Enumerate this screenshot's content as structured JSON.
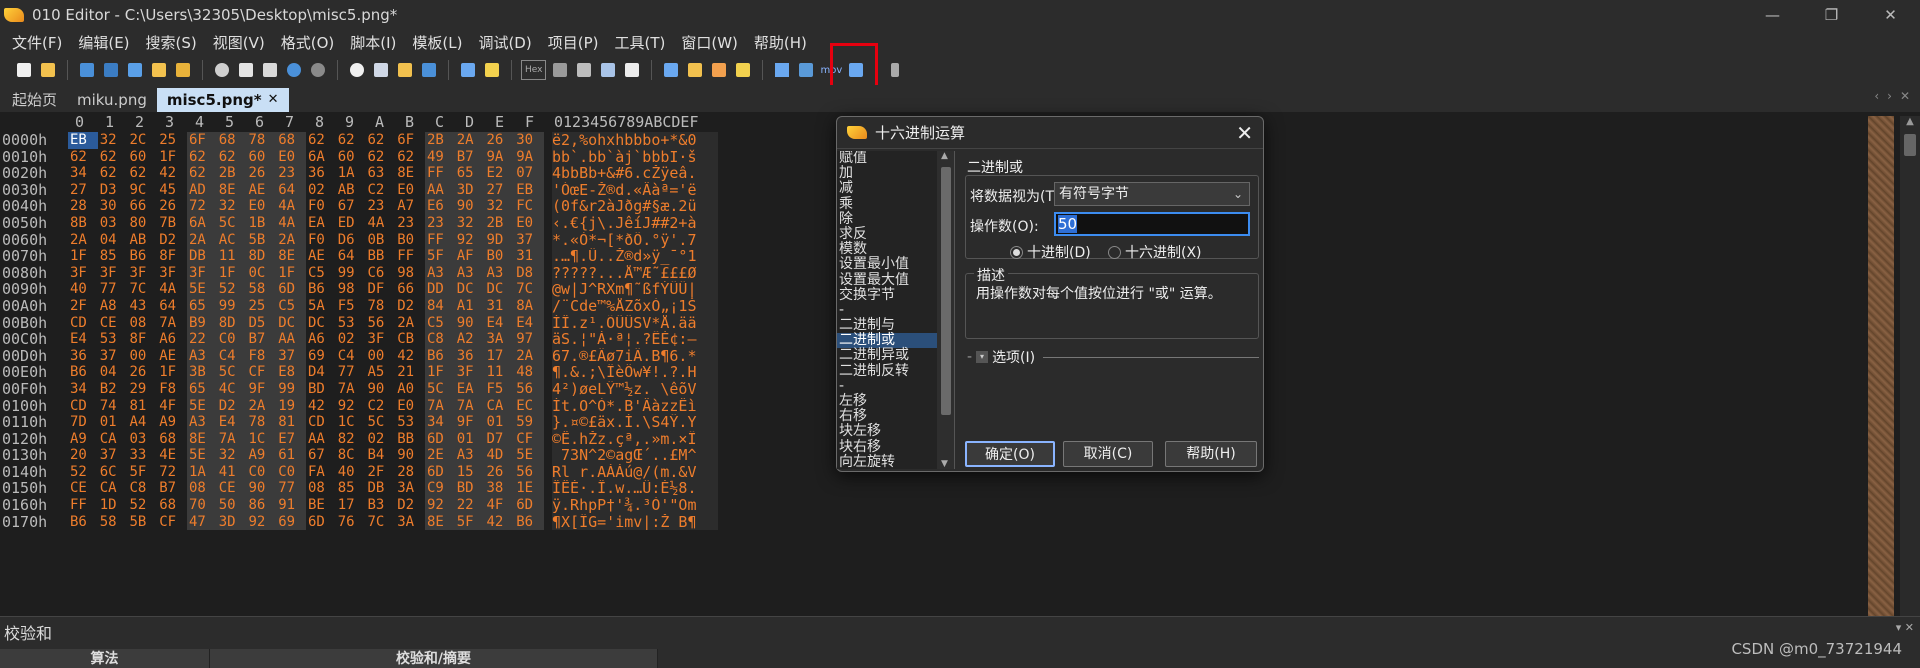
{
  "window": {
    "title": "010 Editor - C:\\Users\\32305\\Desktop\\misc5.png*",
    "controls": [
      "—",
      "❐",
      "✕"
    ]
  },
  "menu": [
    "文件(F)",
    "编辑(E)",
    "搜索(S)",
    "视图(V)",
    "格式(O)",
    "脚本(I)",
    "模板(L)",
    "调试(D)",
    "项目(P)",
    "工具(T)",
    "窗口(W)",
    "帮助(H)"
  ],
  "toolbar": {
    "hex_label": "Hex",
    "mov_label": "mov"
  },
  "tabs": [
    "起始页",
    "miku.png",
    "misc5.png*"
  ],
  "editor": {
    "col_headers": [
      "0",
      "1",
      "2",
      "3",
      "4",
      "5",
      "6",
      "7",
      "8",
      "9",
      "A",
      "B",
      "C",
      "D",
      "E",
      "F"
    ],
    "ascii_header": "0123456789ABCDEF",
    "rows": [
      {
        "addr": "0000h",
        "bytes": [
          "EB",
          "32",
          "2C",
          "25",
          "6F",
          "68",
          "78",
          "68",
          "62",
          "62",
          "62",
          "6F",
          "2B",
          "2A",
          "26",
          "30"
        ],
        "ascii": "ë2,%ohxhbbbo+*&0"
      },
      {
        "addr": "0010h",
        "bytes": [
          "62",
          "62",
          "60",
          "1F",
          "62",
          "62",
          "60",
          "E0",
          "6A",
          "60",
          "62",
          "62",
          "49",
          "B7",
          "9A",
          "9A"
        ],
        "ascii": "bb`.bb`àj`bbbI·š"
      },
      {
        "addr": "0020h",
        "bytes": [
          "34",
          "62",
          "62",
          "42",
          "62",
          "2B",
          "26",
          "23",
          "36",
          "1A",
          "63",
          "8E",
          "FF",
          "65",
          "E2",
          "07"
        ],
        "ascii": "4bbBb+&#6.cŽÿeâ."
      },
      {
        "addr": "0030h",
        "bytes": [
          "27",
          "D3",
          "9C",
          "45",
          "AD",
          "8E",
          "AE",
          "64",
          "02",
          "AB",
          "C2",
          "E0",
          "AA",
          "3D",
          "27",
          "EB"
        ],
        "ascii": "'ÓœE-Ž®d.«Âàª='ë"
      },
      {
        "addr": "0040h",
        "bytes": [
          "28",
          "30",
          "66",
          "26",
          "72",
          "32",
          "E0",
          "4A",
          "F0",
          "67",
          "23",
          "A7",
          "E6",
          "90",
          "32",
          "FC"
        ],
        "ascii": "(0f&r2àJðg#§æ.2ü"
      },
      {
        "addr": "0050h",
        "bytes": [
          "8B",
          "03",
          "80",
          "7B",
          "6A",
          "5C",
          "1B",
          "4A",
          "EA",
          "ED",
          "4A",
          "23",
          "23",
          "32",
          "2B",
          "E0"
        ],
        "ascii": "‹.€{j\\.JêíJ##2+à"
      },
      {
        "addr": "0060h",
        "bytes": [
          "2A",
          "04",
          "AB",
          "D2",
          "2A",
          "AC",
          "5B",
          "2A",
          "F0",
          "D6",
          "0B",
          "B0",
          "FF",
          "92",
          "9D",
          "37"
        ],
        "ascii": "*.«Ò*¬[*ðÖ.°ÿ'.7"
      },
      {
        "addr": "0070h",
        "bytes": [
          "1F",
          "85",
          "B6",
          "8F",
          "DB",
          "11",
          "8D",
          "8E",
          "AE",
          "64",
          "BB",
          "FF",
          "5F",
          "AF",
          "B0",
          "31"
        ],
        "ascii": ".…¶.Û..Ž®d»ÿ_¯°1"
      },
      {
        "addr": "0080h",
        "bytes": [
          "3F",
          "3F",
          "3F",
          "3F",
          "3F",
          "1F",
          "0C",
          "1F",
          "C5",
          "99",
          "C6",
          "98",
          "A3",
          "A3",
          "A3",
          "D8"
        ],
        "ascii": "?????...Å™Æ˜£££Ø"
      },
      {
        "addr": "0090h",
        "bytes": [
          "40",
          "77",
          "7C",
          "4A",
          "5E",
          "52",
          "58",
          "6D",
          "B6",
          "98",
          "DF",
          "66",
          "DD",
          "DC",
          "DC",
          "7C"
        ],
        "ascii": "@w|J^RXm¶˜ßfÝÜÜ|"
      },
      {
        "addr": "00A0h",
        "bytes": [
          "2F",
          "A8",
          "43",
          "64",
          "65",
          "99",
          "25",
          "C5",
          "5A",
          "F5",
          "78",
          "D2",
          "84",
          "A1",
          "31",
          "8A"
        ],
        "ascii": "/¨Cde™%ÅZõxÒ„¡1Š"
      },
      {
        "addr": "00B0h",
        "bytes": [
          "CD",
          "CE",
          "08",
          "7A",
          "B9",
          "8D",
          "D5",
          "DC",
          "DC",
          "53",
          "56",
          "2A",
          "C5",
          "90",
          "E4",
          "E4"
        ],
        "ascii": "ÍÎ.z¹.ÕÜÜSV*Å.ää"
      },
      {
        "addr": "00C0h",
        "bytes": [
          "E4",
          "53",
          "8F",
          "A6",
          "22",
          "C0",
          "B7",
          "AA",
          "A6",
          "02",
          "3F",
          "CB",
          "C8",
          "A2",
          "3A",
          "97"
        ],
        "ascii": "äS.¦\"À·ª¦.?ËÈ¢:—"
      },
      {
        "addr": "00D0h",
        "bytes": [
          "36",
          "37",
          "00",
          "AE",
          "A3",
          "C4",
          "F8",
          "37",
          "69",
          "C4",
          "00",
          "42",
          "B6",
          "36",
          "17",
          "2A"
        ],
        "ascii": "67.®£Äø7iÄ.B¶6.*"
      },
      {
        "addr": "00E0h",
        "bytes": [
          "B6",
          "04",
          "26",
          "1F",
          "3B",
          "5C",
          "CF",
          "E8",
          "D4",
          "77",
          "A5",
          "21",
          "1F",
          "3F",
          "11",
          "48"
        ],
        "ascii": "¶.&.;\\ÏèÔw¥!.?.H"
      },
      {
        "addr": "00F0h",
        "bytes": [
          "34",
          "B2",
          "29",
          "F8",
          "65",
          "4C",
          "9F",
          "99",
          "BD",
          "7A",
          "90",
          "A0",
          "5C",
          "EA",
          "F5",
          "56"
        ],
        "ascii": "4²)øeLŸ™½z. \\êõV"
      },
      {
        "addr": "0100h",
        "bytes": [
          "CD",
          "74",
          "81",
          "4F",
          "5E",
          "D2",
          "2A",
          "19",
          "42",
          "92",
          "C2",
          "E0",
          "7A",
          "7A",
          "CA",
          "EC"
        ],
        "ascii": "Ít.O^Ò*.B'ÂàzzÊì"
      },
      {
        "addr": "0110h",
        "bytes": [
          "7D",
          "01",
          "A4",
          "A9",
          "A3",
          "E4",
          "78",
          "81",
          "CD",
          "1C",
          "5C",
          "53",
          "34",
          "9F",
          "01",
          "59"
        ],
        "ascii": "}.¤©£äx.Í.\\S4Ÿ.Y"
      },
      {
        "addr": "0120h",
        "bytes": [
          "A9",
          "CA",
          "03",
          "68",
          "8E",
          "7A",
          "1C",
          "E7",
          "AA",
          "82",
          "02",
          "BB",
          "6D",
          "01",
          "D7",
          "CF"
        ],
        "ascii": "©Ê.hŽz.çª‚.»m.×Ï"
      },
      {
        "addr": "0130h",
        "bytes": [
          "20",
          "37",
          "33",
          "4E",
          "5E",
          "32",
          "A9",
          "61",
          "67",
          "8C",
          "B4",
          "90",
          "2E",
          "A3",
          "4D",
          "5E"
        ],
        "ascii": " 73N^2©agŒ´..£M^"
      },
      {
        "addr": "0140h",
        "bytes": [
          "52",
          "6C",
          "5F",
          "72",
          "1A",
          "41",
          "C0",
          "C0",
          "FA",
          "40",
          "2F",
          "28",
          "6D",
          "15",
          "26",
          "56"
        ],
        "ascii": "Rl_r.AÀÀú@/(m.&V"
      },
      {
        "addr": "0150h",
        "bytes": [
          "CE",
          "CA",
          "C8",
          "B7",
          "08",
          "CE",
          "90",
          "77",
          "08",
          "85",
          "DB",
          "3A",
          "C9",
          "BD",
          "38",
          "1E"
        ],
        "ascii": "ÎÊÈ·.Î.w.…Û:É½8."
      },
      {
        "addr": "0160h",
        "bytes": [
          "FF",
          "1D",
          "52",
          "68",
          "70",
          "50",
          "86",
          "91",
          "BE",
          "17",
          "B3",
          "D2",
          "92",
          "22",
          "4F",
          "6D"
        ],
        "ascii": "ÿ.RhpP†'¾.³Ò'\"Om"
      },
      {
        "addr": "0170h",
        "bytes": [
          "B6",
          "58",
          "5B",
          "CF",
          "47",
          "3D",
          "92",
          "69",
          "6D",
          "76",
          "7C",
          "3A",
          "8E",
          "5F",
          "42",
          "B6"
        ],
        "ascii": "¶X[ÏG='imv|:Ž_B¶"
      }
    ]
  },
  "checksum_panel": {
    "title": "校验和",
    "controls": "▾ ✕",
    "columns": [
      "算法",
      "校验和/摘要"
    ]
  },
  "watermark": "CSDN @m0_73721944",
  "dialog": {
    "title": "十六进制运算",
    "close": "✕",
    "operations": [
      "赋值",
      "加",
      "减",
      "乘",
      "除",
      "求反",
      "模数",
      "设置最小值",
      "设置最大值",
      "交换字节",
      "-",
      "二进制与",
      "二进制或",
      "二进制异或",
      "二进制反转",
      "-",
      "左移",
      "右移",
      "块左移",
      "块右移",
      "向左旋转",
      "向右旋转"
    ],
    "selected_operation": "二进制或",
    "group_label": "二进制或",
    "treat_as_label": "将数据视为(T):",
    "treat_as_value": "有符号字节",
    "operand_label": "操作数(O):",
    "operand_value": "50",
    "radio_decimal": "十进制(D)",
    "radio_hex": "十六进制(X)",
    "radio_selected": "decimal",
    "description_title": "描述",
    "description_text": "用操作数对每个值按位进行 \"或\" 运算。",
    "options_label": "选项(I)",
    "ok_label": "确定(O)",
    "cancel_label": "取消(C)",
    "help_label": "帮助(H)"
  }
}
